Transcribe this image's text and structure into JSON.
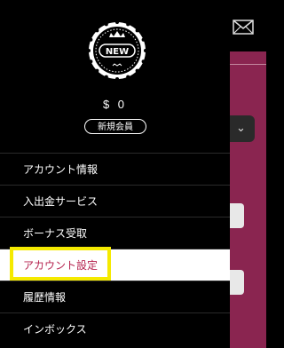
{
  "profile": {
    "badge_text": "NEW",
    "balance": "$ 0",
    "membership": "新規会員"
  },
  "menu": {
    "items": [
      {
        "label": "アカウント情報",
        "active": false
      },
      {
        "label": "入出金サービス",
        "active": false
      },
      {
        "label": "ボーナス受取",
        "active": false
      },
      {
        "label": "アカウント設定",
        "active": true
      },
      {
        "label": "履歴情報",
        "active": false
      },
      {
        "label": "インボックス",
        "active": false
      }
    ]
  },
  "icons": {
    "mail": "mail-icon",
    "dropdown": "chevron-down-icon"
  },
  "colors": {
    "drawer_bg": "#000000",
    "active_text": "#b5234f",
    "highlight_border": "#f5ea00",
    "app_bg": "#8a2550"
  }
}
